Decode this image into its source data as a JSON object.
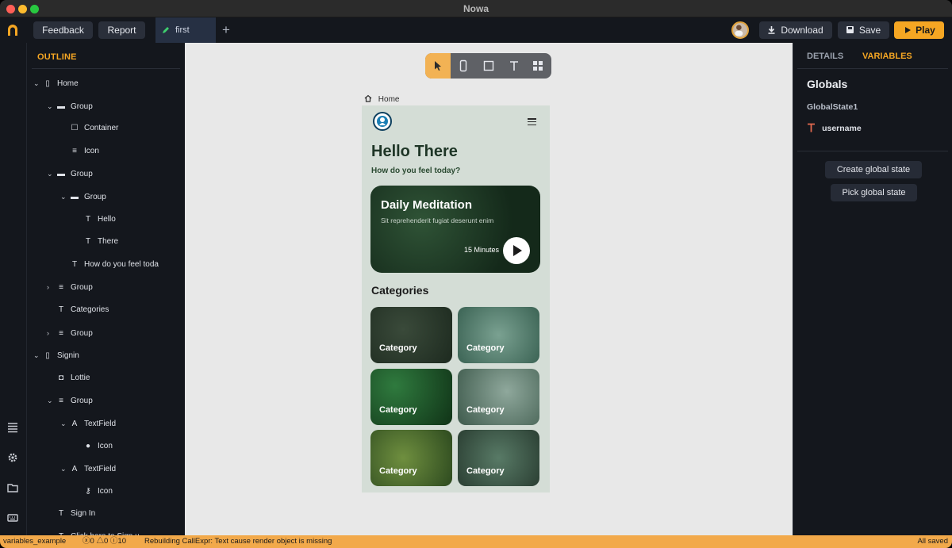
{
  "window": {
    "title": "Nowa",
    "traffic_lights": [
      "#ff5f57",
      "#febc2e",
      "#28c840"
    ]
  },
  "toolbar": {
    "feedback_label": "Feedback",
    "report_label": "Report",
    "tab_label": "first",
    "download_label": "Download",
    "save_label": "Save",
    "play_label": "Play",
    "accent": "#f5a623"
  },
  "outline": {
    "title": "OUTLINE",
    "nodes": [
      {
        "label": "Home",
        "icon": "phone-icon",
        "expand": "down"
      },
      {
        "label": "Group",
        "icon": "group-icon",
        "expand": "down"
      },
      {
        "label": "Container",
        "icon": "square-icon",
        "expand": ""
      },
      {
        "label": "Icon",
        "icon": "lines-icon",
        "expand": ""
      },
      {
        "label": "Group",
        "icon": "group-icon",
        "expand": "down"
      },
      {
        "label": "Group",
        "icon": "group-icon",
        "expand": "down"
      },
      {
        "label": "Hello",
        "icon": "text-icon",
        "expand": ""
      },
      {
        "label": "There",
        "icon": "text-icon",
        "expand": ""
      },
      {
        "label": "How do you feel toda",
        "icon": "text-icon",
        "expand": ""
      },
      {
        "label": "Group",
        "icon": "lines-icon",
        "expand": "right"
      },
      {
        "label": "Categories",
        "icon": "text-icon",
        "expand": ""
      },
      {
        "label": "Group",
        "icon": "lines-icon",
        "expand": "right"
      },
      {
        "label": "Signin",
        "icon": "phone-icon",
        "expand": "down"
      },
      {
        "label": "Lottie",
        "icon": "lottie-icon",
        "expand": ""
      },
      {
        "label": "Group",
        "icon": "lines-icon",
        "expand": "down"
      },
      {
        "label": "TextField",
        "icon": "textfield-icon",
        "expand": "down"
      },
      {
        "label": "Icon",
        "icon": "person-icon",
        "expand": ""
      },
      {
        "label": "TextField",
        "icon": "textfield-icon",
        "expand": "down"
      },
      {
        "label": "Icon",
        "icon": "key-icon",
        "expand": ""
      },
      {
        "label": "Sign In",
        "icon": "text-icon",
        "expand": ""
      },
      {
        "label": "Click here to Sign u",
        "icon": "text-icon",
        "expand": ""
      }
    ]
  },
  "canvas": {
    "breadcrumb": "Home",
    "app": {
      "title": "Hello There",
      "subtitle": "How do you feel today?",
      "card_title": "Daily Meditation",
      "card_text": "Sit reprehenderit fugiat deserunt enim",
      "card_duration": "15 Minutes",
      "categories_heading": "Categories",
      "category_tiles": [
        "Category",
        "Category",
        "Category",
        "Category",
        "Category",
        "Category"
      ]
    }
  },
  "right_panel": {
    "tabs": [
      "DETAILS",
      "VARIABLES"
    ],
    "active_tab": "VARIABLES",
    "section_title": "Globals",
    "state_name": "GlobalState1",
    "variable_name": "username",
    "create_label": "Create global state",
    "pick_label": "Pick global state"
  },
  "status_bar": {
    "project": "variables_example",
    "errors": "0",
    "warnings": "0",
    "infos": "10",
    "message": "Rebuilding CallExpr: Text cause render object is missing",
    "saved": "All saved"
  }
}
